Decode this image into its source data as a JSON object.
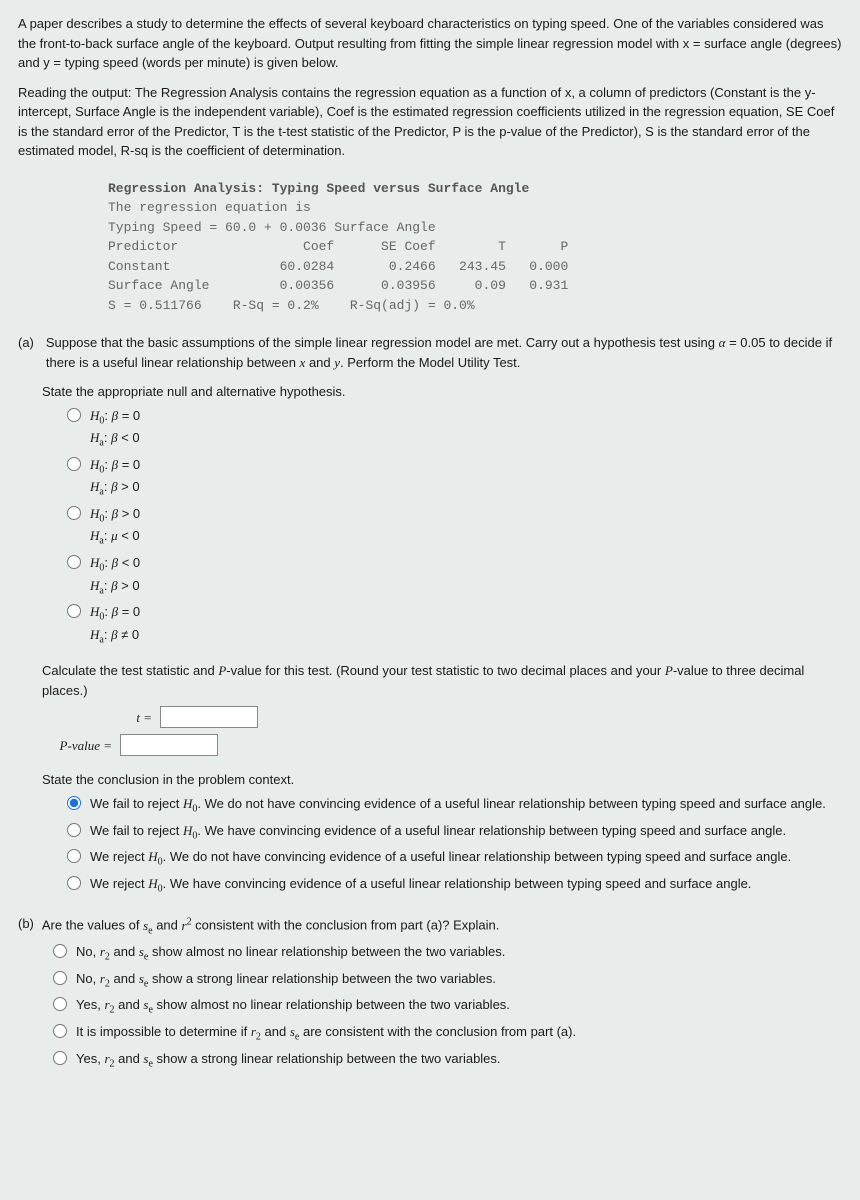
{
  "intro": {
    "p1": "A paper describes a study to determine the effects of several keyboard characteristics on typing speed. One of the variables considered was the front-to-back surface angle of the keyboard. Output resulting from fitting the simple linear regression model with x = surface angle (degrees) and y = typing speed (words per minute) is given below.",
    "p2": "Reading the output: The Regression Analysis contains the regression equation as a function of x, a column of predictors (Constant is the y-intercept, Surface Angle is the independent variable), Coef is the estimated regression coefficients utilized in the regression equation, SE Coef is the standard error of the Predictor, T is the t-test statistic of the Predictor, P is the p-value of the Predictor), S is the standard error of the estimated model, R-sq is the coefficient of determination."
  },
  "regout": {
    "title": "Regression Analysis: Typing Speed versus Surface Angle",
    "l1": "The regression equation is",
    "l2": "Typing Speed = 60.0 + 0.0036 Surface Angle",
    "hdr": "Predictor                Coef      SE Coef        T       P",
    "r1": "Constant              60.0284       0.2466   243.45   0.000",
    "r2": "Surface Angle         0.00356      0.03956     0.09   0.931",
    "r3": "S = 0.511766    R-Sq = 0.2%    R-Sq(adj) = 0.0%"
  },
  "a": {
    "label": "(a)",
    "prompt": "Suppose that the basic assumptions of the simple linear regression model are met. Carry out a hypothesis test using α = 0.05 to decide if there is a useful linear relationship between x and y. Perform the Model Utility Test.",
    "hypo_head": "State the appropriate null and alternative hypothesis.",
    "opts": [
      {
        "h0": "β = 0",
        "ha": "β < 0"
      },
      {
        "h0": "β = 0",
        "ha": "β > 0"
      },
      {
        "h0": "β > 0",
        "ha": "μ < 0"
      },
      {
        "h0": "β < 0",
        "ha": "β > 0"
      },
      {
        "h0": "β = 0",
        "ha": "β ≠ 0"
      }
    ],
    "calc_head": "Calculate the test statistic and P-value for this test. (Round your test statistic to two decimal places and your P-value to three decimal places.)",
    "t_label": "t =",
    "p_label": "P-value =",
    "concl_head": "State the conclusion in the problem context.",
    "concl": [
      "We fail to reject H₀. We do not have convincing evidence of a useful linear relationship between typing speed and surface angle.",
      "We fail to reject H₀. We have convincing evidence of a useful linear relationship between typing speed and surface angle.",
      "We reject H₀. We do not have convincing evidence of a useful linear relationship between typing speed and surface angle.",
      "We reject H₀. We have convincing evidence of a useful linear relationship between typing speed and surface angle."
    ]
  },
  "b": {
    "label": "(b)",
    "prompt": "Are the values of sₑ and r² consistent with the conclusion from part (a)? Explain.",
    "opts": [
      "No, r₂ and sₑ show almost no linear relationship between the two variables.",
      "No, r₂ and sₑ show a strong linear relationship between the two variables.",
      "Yes, r₂ and sₑ show almost no linear relationship between the two variables.",
      "It is impossible to determine if r₂ and sₑ are consistent with the conclusion from part (a).",
      "Yes, r₂ and sₑ show a strong linear relationship between the two variables."
    ]
  }
}
